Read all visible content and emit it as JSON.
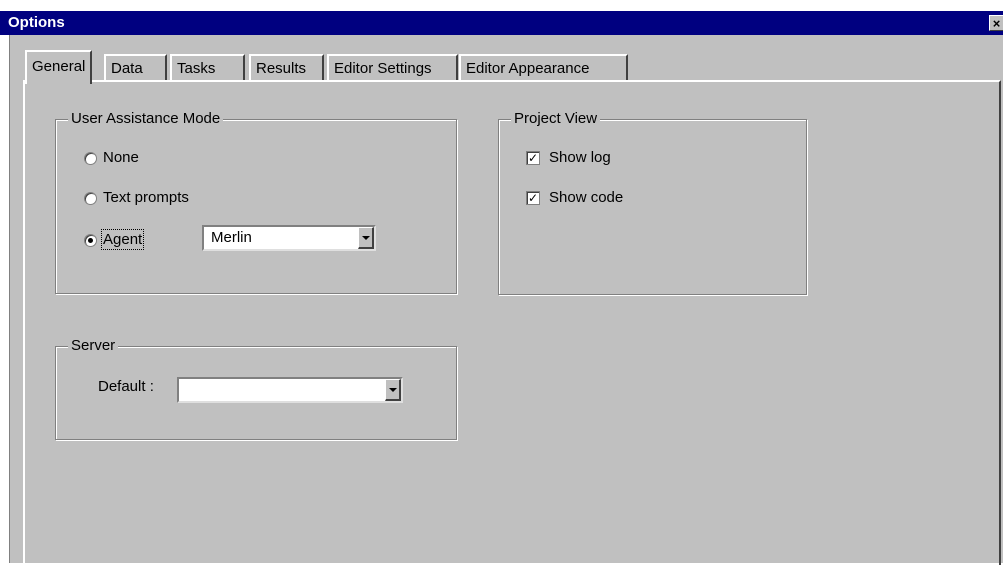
{
  "window": {
    "title": "Options",
    "close_glyph": "×"
  },
  "tabs": [
    {
      "label": "General",
      "active": true
    },
    {
      "label": "Data"
    },
    {
      "label": "Tasks"
    },
    {
      "label": "Results"
    },
    {
      "label": "Editor Settings"
    },
    {
      "label": "Editor Appearance"
    }
  ],
  "user_assistance": {
    "title": "User Assistance Mode",
    "options": [
      {
        "label": "None",
        "checked": false
      },
      {
        "label": "Text prompts",
        "checked": false
      },
      {
        "label": "Agent",
        "checked": true
      }
    ],
    "agent_select": {
      "value": "Merlin"
    }
  },
  "project_view": {
    "title": "Project View",
    "show_log": {
      "label": "Show log",
      "checked": true
    },
    "show_code": {
      "label": "Show code",
      "checked": true
    },
    "check_glyph": "✓"
  },
  "server": {
    "title": "Server",
    "default_label": "Default :",
    "default_value": ""
  },
  "colors": {
    "titlebar": "#000080",
    "face": "#c0c0c0"
  }
}
